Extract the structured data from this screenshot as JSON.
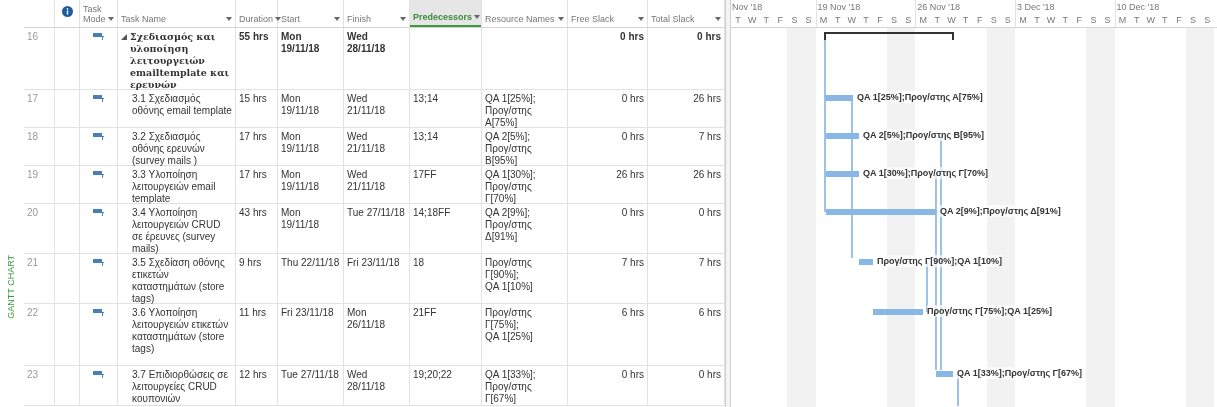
{
  "side_label": "GANTT CHART",
  "columns": [
    {
      "kind": "id"
    },
    {
      "kind": "info"
    },
    {
      "kind": "text",
      "label": "Task Mode",
      "filter": true,
      "selected": false
    },
    {
      "kind": "text",
      "label": "Task Name",
      "filter": true,
      "selected": false
    },
    {
      "kind": "text",
      "label": "Duration",
      "filter": true,
      "selected": false
    },
    {
      "kind": "text",
      "label": "Start",
      "filter": true,
      "selected": false
    },
    {
      "kind": "text",
      "label": "Finish",
      "filter": true,
      "selected": false
    },
    {
      "kind": "text",
      "label": "Predecessors",
      "filter": true,
      "selected": true
    },
    {
      "kind": "text",
      "label": "Resource Names",
      "filter": true,
      "selected": false
    },
    {
      "kind": "text",
      "label": "Free Slack",
      "filter": true,
      "selected": false
    },
    {
      "kind": "text",
      "label": "Total Slack",
      "filter": true,
      "selected": false
    }
  ],
  "timeline": [
    {
      "label": "Nov '18",
      "days": [
        {
          "letter": "T",
          "weekend": false
        },
        {
          "letter": "W",
          "weekend": false
        },
        {
          "letter": "T",
          "weekend": false
        },
        {
          "letter": "F",
          "weekend": false
        },
        {
          "letter": "S",
          "weekend": true
        },
        {
          "letter": "S",
          "weekend": true
        }
      ]
    },
    {
      "label": "19 Nov '18",
      "days": [
        {
          "letter": "M",
          "weekend": false
        },
        {
          "letter": "T",
          "weekend": false
        },
        {
          "letter": "W",
          "weekend": false
        },
        {
          "letter": "T",
          "weekend": false
        },
        {
          "letter": "F",
          "weekend": false
        },
        {
          "letter": "S",
          "weekend": true
        },
        {
          "letter": "S",
          "weekend": true
        }
      ]
    },
    {
      "label": "26 Nov '18",
      "days": [
        {
          "letter": "M",
          "weekend": false
        },
        {
          "letter": "T",
          "weekend": false
        },
        {
          "letter": "W",
          "weekend": false
        },
        {
          "letter": "T",
          "weekend": false
        },
        {
          "letter": "F",
          "weekend": false
        },
        {
          "letter": "S",
          "weekend": true
        },
        {
          "letter": "S",
          "weekend": true
        }
      ]
    },
    {
      "label": "3 Dec '18",
      "days": [
        {
          "letter": "M",
          "weekend": false
        },
        {
          "letter": "T",
          "weekend": false
        },
        {
          "letter": "W",
          "weekend": false
        },
        {
          "letter": "T",
          "weekend": false
        },
        {
          "letter": "F",
          "weekend": false
        },
        {
          "letter": "S",
          "weekend": true
        },
        {
          "letter": "S",
          "weekend": true
        }
      ]
    },
    {
      "label": "10 Dec '18",
      "days": [
        {
          "letter": "M",
          "weekend": false
        },
        {
          "letter": "T",
          "weekend": false
        },
        {
          "letter": "W",
          "weekend": false
        },
        {
          "letter": "T",
          "weekend": false
        },
        {
          "letter": "F",
          "weekend": false
        },
        {
          "letter": "S",
          "weekend": true
        },
        {
          "letter": "S",
          "weekend": true
        }
      ]
    }
  ],
  "rows": [
    {
      "id": "16",
      "summary": true,
      "expanded": true,
      "name": "Σχεδιασμός και υλοποίηση λειτουργειών emailtemplate και ερευνών",
      "duration": "55 hrs",
      "start": "Mon 19/11/18",
      "finish": "Wed 28/11/18",
      "free_slack": "0 hrs",
      "total_slack": "0 hrs"
    },
    {
      "id": "17",
      "summary": false,
      "name": "3.1 Σχεδιασμός οθόνης email template",
      "duration": "15 hrs",
      "start": "Mon 19/11/18",
      "finish": "Wed 21/11/18",
      "predecessors": "13;14",
      "resources": "QA 1[25%];\nΠρογ/στης Α[75%]",
      "free_slack": "0 hrs",
      "total_slack": "26 hrs",
      "bar_label": "QA 1[25%];Προγ/στης Α[75%]"
    },
    {
      "id": "18",
      "summary": false,
      "name": "3.2 Σχεδιασμός οθόνης ερευνών (survey mails )",
      "duration": "17 hrs",
      "start": "Mon 19/11/18",
      "finish": "Wed 21/11/18",
      "predecessors": "13;14",
      "resources": "QA 2[5%];\nΠρογ/στης Β[95%]",
      "free_slack": "0 hrs",
      "total_slack": "7 hrs",
      "bar_label": "QA 2[5%];Προγ/στης Β[95%]"
    },
    {
      "id": "19",
      "summary": false,
      "name": "3.3 Υλοποίηση λειτουργειών email template",
      "duration": "17 hrs",
      "start": "Mon 19/11/18",
      "finish": "Wed 21/11/18",
      "predecessors": "17FF",
      "resources": "QA 1[30%];\nΠρογ/στης Γ[70%]",
      "free_slack": "26 hrs",
      "total_slack": "26 hrs",
      "bar_label": "QA 1[30%];Προγ/στης Γ[70%]"
    },
    {
      "id": "20",
      "summary": false,
      "name": "3.4 Υλοποίηση λειτουργειών CRUD σε έρευνες (survey mails)",
      "duration": "43 hrs",
      "start": "Mon 19/11/18",
      "finish": "Tue 27/11/18",
      "predecessors": "14;18FF",
      "resources": "QA 2[9%];\nΠρογ/στης Δ[91%]",
      "free_slack": "0 hrs",
      "total_slack": "0 hrs",
      "bar_label": "QA 2[9%];Προγ/στης Δ[91%]"
    },
    {
      "id": "21",
      "summary": false,
      "name": "3.5 Σχεδίαση οθόνης ετικετών καταστημάτων (store tags)",
      "duration": "9 hrs",
      "start": "Thu 22/11/18",
      "finish": "Fri 23/11/18",
      "predecessors": "18",
      "resources": "Προγ/στης Γ[90%];\nQA 1[10%]",
      "free_slack": "7 hrs",
      "total_slack": "7 hrs",
      "bar_label": "Προγ/στης Γ[90%];QA 1[10%]"
    },
    {
      "id": "22",
      "summary": false,
      "name": "3.6 Υλοποίηση λειτουργειών ετικετών καταστημάτων (store tags)",
      "duration": "11 hrs",
      "start": "Fri 23/11/18",
      "finish": "Mon 26/11/18",
      "predecessors": "21FF",
      "resources": "Προγ/στης Γ[75%];\nQA 1[25%]",
      "free_slack": "6 hrs",
      "total_slack": "6 hrs",
      "bar_label": "Προγ/στης Γ[75%];QA 1[25%]"
    },
    {
      "id": "23",
      "summary": false,
      "name": "3.7 Επιδιορθώσεις σε λειτουργείες CRUD κουπονιών",
      "duration": "12 hrs",
      "start": "Tue 27/11/18",
      "finish": "Wed 28/11/18",
      "predecessors": "19;20;22",
      "resources": "QA 1[33%];\nΠρογ/στης Γ[67%]",
      "free_slack": "0 hrs",
      "total_slack": "0 hrs",
      "bar_label": "QA 1[33%];Προγ/στης Γ[67%]"
    }
  ]
}
